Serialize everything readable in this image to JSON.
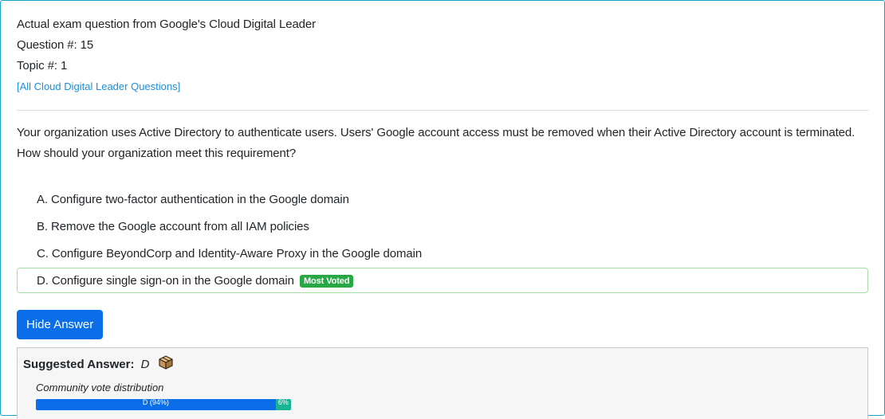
{
  "header": {
    "exam_line": "Actual exam question from Google's Cloud Digital Leader",
    "question_number": "Question #: 15",
    "topic_number": "Topic #: 1",
    "all_questions_link": "[All Cloud Digital Leader Questions]"
  },
  "question": {
    "text_line1": "Your organization uses Active Directory to authenticate users. Users' Google account access must be removed when their Active Directory account is terminated.",
    "text_line2": "How should your organization meet this requirement?"
  },
  "choices": [
    {
      "label": "A. Configure two-factor authentication in the Google domain"
    },
    {
      "label": "B. Remove the Google account from all IAM policies"
    },
    {
      "label": "C. Configure BeyondCorp and Identity-Aware Proxy in the Google domain"
    },
    {
      "label": "D. Configure single sign-on in the Google domain",
      "badge": "Most Voted"
    }
  ],
  "hide_answer_button": "Hide Answer",
  "suggested_answer": {
    "label": "Suggested Answer:",
    "value": "D",
    "icon": "box-icon"
  },
  "community_vote": {
    "title": "Community vote distribution",
    "segments": [
      {
        "label": "D (94%)",
        "fraction": 0.94
      },
      {
        "label": "6%",
        "fraction": 0.06
      }
    ]
  },
  "colors": {
    "accent": "#0a6ee8",
    "link": "#1b8fd6",
    "most_voted_badge": "#28a745",
    "correct_border": "#a8dba8",
    "vote_other": "#1ab394"
  }
}
